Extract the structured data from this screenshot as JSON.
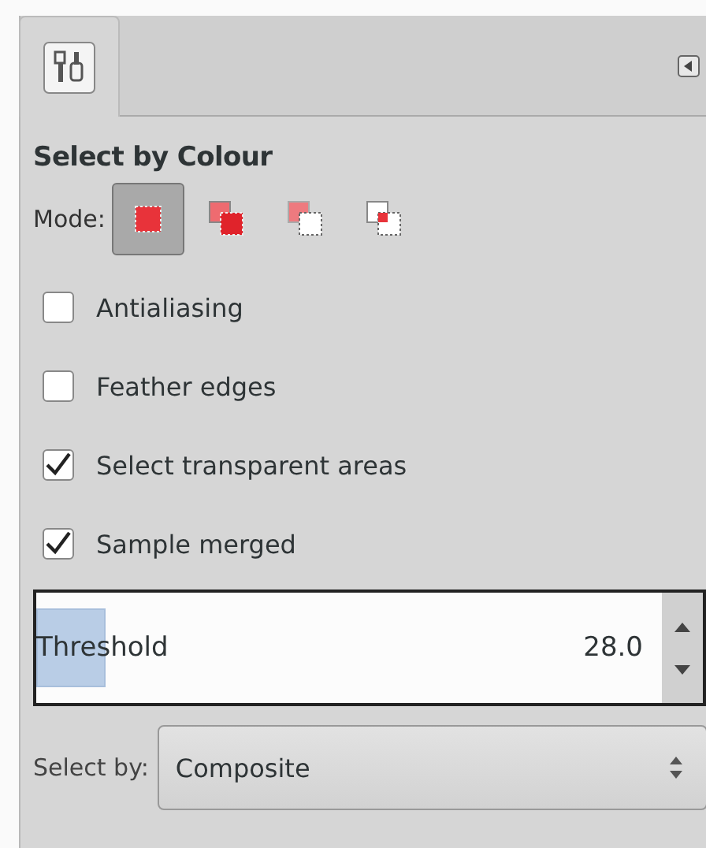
{
  "tabs": [
    {
      "kind": "tool-options",
      "selected": true
    }
  ],
  "title": "Select by Colour",
  "mode": {
    "label": "Mode:",
    "options": [
      {
        "kind": "replace",
        "selected": true
      },
      {
        "kind": "add",
        "selected": false
      },
      {
        "kind": "subtract",
        "selected": false
      },
      {
        "kind": "intersect",
        "selected": false
      }
    ]
  },
  "options": [
    {
      "label": "Antialiasing",
      "checked": false
    },
    {
      "label": "Feather edges",
      "checked": false
    },
    {
      "label": "Select transparent areas",
      "checked": true
    },
    {
      "label": "Sample merged",
      "checked": true
    }
  ],
  "threshold": {
    "label": "Threshold",
    "value": "28.0",
    "level": 0.11
  },
  "select_by": {
    "label": "Select by:",
    "value": "Composite"
  }
}
